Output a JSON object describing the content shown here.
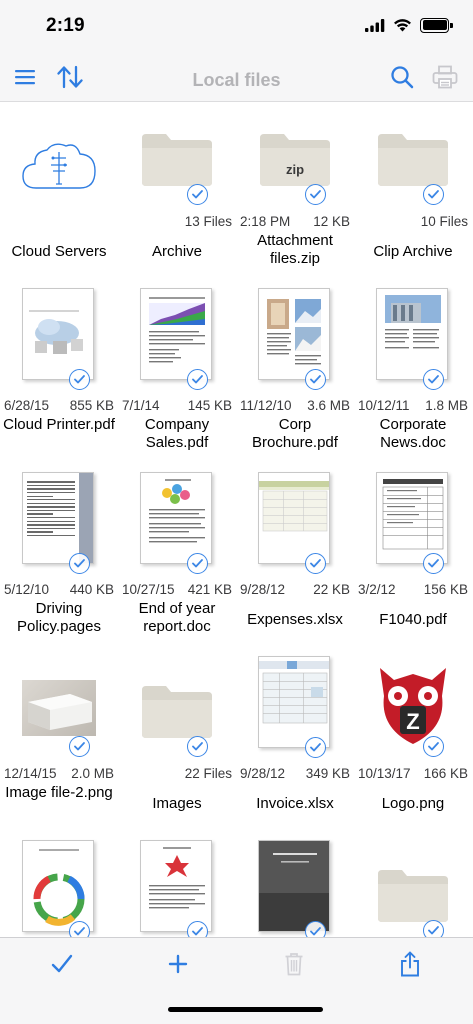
{
  "status_bar": {
    "time": "2:19"
  },
  "nav": {
    "title": "Local files",
    "accent": "#2f7de1",
    "disabled": "#c7c7cc"
  },
  "items": [
    {
      "name": "Cloud Servers",
      "date": "",
      "size": "",
      "kind": "cloud"
    },
    {
      "name": "Archive",
      "date": "",
      "size": "13 Files",
      "kind": "folder"
    },
    {
      "name": "Attachment files.zip",
      "date": "2:18 PM",
      "size": "12 KB",
      "kind": "zip",
      "zip_label": "zip"
    },
    {
      "name": "Clip Archive",
      "date": "",
      "size": "10 Files",
      "kind": "folder"
    },
    {
      "name": "Cloud Printer.pdf",
      "date": "6/28/15",
      "size": "855 KB",
      "kind": "doc"
    },
    {
      "name": "Company Sales.pdf",
      "date": "7/1/14",
      "size": "145 KB",
      "kind": "doc"
    },
    {
      "name": "Corp Brochure.pdf",
      "date": "11/12/10",
      "size": "3.6 MB",
      "kind": "doc"
    },
    {
      "name": "Corporate News.doc",
      "date": "10/12/11",
      "size": "1.8 MB",
      "kind": "doc"
    },
    {
      "name": "Driving Policy.pages",
      "date": "5/12/10",
      "size": "440 KB",
      "kind": "doc"
    },
    {
      "name": "End of year report.doc",
      "date": "10/27/15",
      "size": "421 KB",
      "kind": "doc"
    },
    {
      "name": "Expenses.xlsx",
      "date": "9/28/12",
      "size": "22 KB",
      "kind": "sheet"
    },
    {
      "name": "F1040.pdf",
      "date": "3/2/12",
      "size": "156 KB",
      "kind": "doc"
    },
    {
      "name": "Image file-2.png",
      "date": "12/14/15",
      "size": "2.0 MB",
      "kind": "image"
    },
    {
      "name": "Images",
      "date": "",
      "size": "22 Files",
      "kind": "folder"
    },
    {
      "name": "Invoice.xlsx",
      "date": "9/28/12",
      "size": "349 KB",
      "kind": "sheet"
    },
    {
      "name": "Logo.png",
      "date": "10/13/17",
      "size": "166 KB",
      "kind": "image"
    },
    {
      "name": "",
      "date": "",
      "size": "",
      "kind": "doc"
    },
    {
      "name": "",
      "date": "",
      "size": "",
      "kind": "doc"
    },
    {
      "name": "",
      "date": "",
      "size": "",
      "kind": "doc"
    },
    {
      "name": "",
      "date": "",
      "size": "",
      "kind": "folder"
    }
  ],
  "icons": {
    "menu": "menu-icon",
    "sort": "sort-icon",
    "search": "search-icon",
    "print": "printer-icon",
    "select": "checkmark-icon",
    "add": "plus-icon",
    "delete": "trash-icon",
    "share": "share-icon"
  }
}
